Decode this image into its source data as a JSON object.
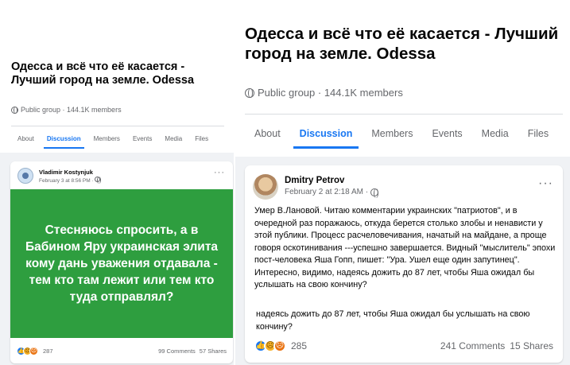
{
  "left": {
    "group": {
      "title": "Одесса и всё что её касается - Лучший город на земле. Odessa",
      "meta": "Public group · 144.1K members"
    },
    "tabs": [
      {
        "label": "About"
      },
      {
        "label": "Discussion",
        "active": true
      },
      {
        "label": "Members"
      },
      {
        "label": "Events"
      },
      {
        "label": "Media"
      },
      {
        "label": "Files"
      }
    ],
    "post": {
      "author": "Vladimir Kostynjuk",
      "time": "February 3 at 8:56 PM · ",
      "more": "···",
      "image_text": "Стесняюсь спросить, а в Бабином Яру украинская элита кому дань уважения отдавала - тем кто там лежит или тем кто туда отправлял?",
      "reactions_count": "287",
      "comments": "99 Comments",
      "shares": "57 Shares",
      "image_color": "#2e9e3f"
    }
  },
  "right": {
    "group": {
      "title": "Одесса и всё что её касается - Лучший город на земле. Odessa",
      "meta": "Public group · 144.1K members"
    },
    "tabs": [
      {
        "label": "About"
      },
      {
        "label": "Discussion",
        "active": true
      },
      {
        "label": "Members"
      },
      {
        "label": "Events"
      },
      {
        "label": "Media"
      },
      {
        "label": "Files"
      }
    ],
    "post": {
      "author": "Dmitry Petrov",
      "time": "February 2 at 2:18 AM · ",
      "more": "···",
      "text": "Умер В.Лановой. Читаю комментарии украинских \"патриотов\", и в очередной раз поражаюсь, откуда берется столько злобы и ненависти у этой публики. Процесс расчеловечивания, начатый на майдане, а проще говоря оскотинивания ---успешно завершается. Видный \"мыслитель\" эпохи пост-человека Яша Гопп, пишет: \"Ура. Ушел еще один запутинец\". Интересно, видимо, надеясь дожить до 87 лет, чтобы Яша ожидал бы услышать на свою кончину?",
      "quote": "надеясь дожить до 87 лет, чтобы Яша ожидал бы услышать на свою кончину?",
      "reactions_count": "285",
      "comments": "241 Comments",
      "shares": "15 Shares"
    }
  },
  "icons": {
    "globe": "globe-icon",
    "like": "like-reaction-icon",
    "sad": "sad-reaction-icon",
    "angry": "angry-reaction-icon"
  },
  "colors": {
    "accent": "#1877f2",
    "feed_bg": "#f0f2f5",
    "muted_text": "#65676b"
  }
}
